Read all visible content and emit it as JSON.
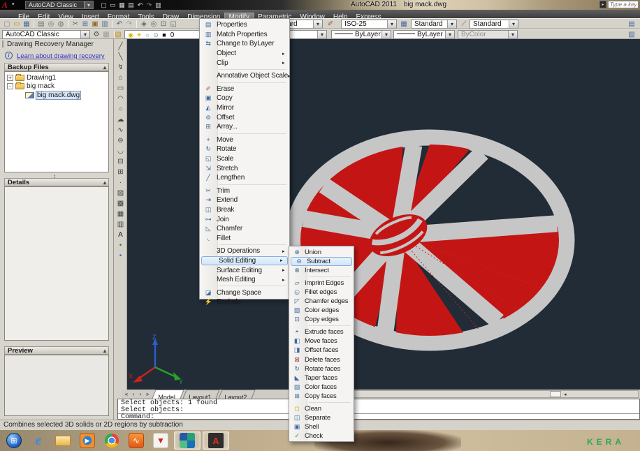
{
  "window": {
    "workspace": "AutoCAD Classic",
    "title_app": "AutoCAD 2011",
    "title_doc": "big mack.dwg",
    "search_placeholder": "Type a keyw",
    "menu_items": [
      {
        "label": "File"
      },
      {
        "label": "Edit"
      },
      {
        "label": "View"
      },
      {
        "label": "Insert"
      },
      {
        "label": "Format"
      },
      {
        "label": "Tools"
      },
      {
        "label": "Draw"
      },
      {
        "label": "Dimension"
      },
      {
        "label": "Modify",
        "cls": "active"
      },
      {
        "label": "Parametric"
      },
      {
        "label": "Window"
      },
      {
        "label": "Help"
      },
      {
        "label": "Express"
      }
    ],
    "qat_icons": [
      {
        "name": "qat-new-icon",
        "glyph": "▢",
        "color": "#ddd"
      },
      {
        "name": "qat-open-icon",
        "glyph": "▭",
        "color": "#ddd"
      },
      {
        "name": "qat-save-icon",
        "glyph": "▦",
        "color": "#ddd"
      },
      {
        "name": "qat-plot-icon",
        "glyph": "▤",
        "color": "#ddd"
      },
      {
        "name": "qat-undo-icon",
        "glyph": "↶",
        "color": "#ddd"
      },
      {
        "name": "qat-redo-icon",
        "glyph": "↷",
        "color": "#888"
      },
      {
        "name": "qat-print-icon",
        "glyph": "▥",
        "color": "#ddd"
      }
    ]
  },
  "toolbar_main": {
    "icons": [
      {
        "name": "new-icon",
        "glyph": "▢",
        "color": "#888"
      },
      {
        "name": "open-icon",
        "glyph": "▭",
        "color": "#c09020"
      },
      {
        "name": "save-icon",
        "glyph": "▦",
        "color": "#4a6da0"
      },
      {
        "type": "sep"
      },
      {
        "name": "plot-icon",
        "glyph": "▤",
        "color": "#777"
      },
      {
        "name": "plot-preview-icon",
        "glyph": "◎",
        "color": "#777"
      },
      {
        "name": "publish-icon",
        "glyph": "◍",
        "color": "#777"
      },
      {
        "type": "sep"
      },
      {
        "name": "cut-icon",
        "glyph": "✂",
        "color": "#666"
      },
      {
        "name": "copy-clip-icon",
        "glyph": "⊞",
        "color": "#4a6da0"
      },
      {
        "name": "paste-icon",
        "glyph": "▣",
        "color": "#8a6a30"
      },
      {
        "name": "match-properties-icon",
        "glyph": "▥",
        "color": "#4a6da0"
      },
      {
        "type": "sep"
      },
      {
        "name": "undo-icon",
        "glyph": "↶",
        "color": "#3a5a9a"
      },
      {
        "name": "redo-icon",
        "glyph": "↷",
        "color": "#9aa0a8"
      },
      {
        "type": "sep"
      },
      {
        "name": "pan-icon",
        "glyph": "◈",
        "color": "#666"
      },
      {
        "name": "zoom-realtime-icon",
        "glyph": "◎",
        "color": "#666"
      },
      {
        "name": "zoom-window-icon",
        "glyph": "⊡",
        "color": "#666"
      },
      {
        "name": "zoom-previous-icon",
        "glyph": "◱",
        "color": "#666"
      }
    ],
    "text_style": "Standard",
    "dim_style": "ISO-25",
    "table_style": "Standard",
    "multileader_style": "Standard"
  },
  "toolbar_secondary": {
    "workspace": "AutoCAD Classic",
    "layer_icons": [
      {
        "name": "layer-bulb-icon",
        "glyph": "◉",
        "color": "#d8b400"
      },
      {
        "name": "layer-sun-icon",
        "glyph": "☀",
        "color": "#d8b400"
      },
      {
        "name": "layer-freeze-icon",
        "glyph": "☼",
        "color": "#8898a8"
      },
      {
        "name": "layer-lock-icon",
        "glyph": "⊙",
        "color": "#888"
      },
      {
        "name": "layer-color-swatch",
        "glyph": "■",
        "color": "#111"
      }
    ],
    "layer": "0",
    "linetype": "ByLayer",
    "lineweight": "ByLayer",
    "plotstyle": "ByColor"
  },
  "draw_toolbar": {
    "icons": [
      {
        "name": "line-icon",
        "glyph": "╱"
      },
      {
        "name": "construction-line-icon",
        "glyph": "╲"
      },
      {
        "name": "polyline-icon",
        "glyph": "↯"
      },
      {
        "name": "polygon-icon",
        "glyph": "⌂"
      },
      {
        "name": "rectangle-icon",
        "glyph": "▭"
      },
      {
        "name": "arc-icon",
        "glyph": "◠"
      },
      {
        "name": "circle-icon",
        "glyph": "○"
      },
      {
        "name": "revision-cloud-icon",
        "glyph": "☁"
      },
      {
        "name": "spline-icon",
        "glyph": "∿"
      },
      {
        "name": "ellipse-icon",
        "glyph": "⊜"
      },
      {
        "name": "ellipse-arc-icon",
        "glyph": "◡"
      },
      {
        "name": "insert-block-icon",
        "glyph": "⊟"
      },
      {
        "name": "make-block-icon",
        "glyph": "⊞"
      },
      {
        "name": "point-icon",
        "glyph": "·"
      },
      {
        "name": "hatch-icon",
        "glyph": "▨"
      },
      {
        "name": "gradient-icon",
        "glyph": "▩"
      },
      {
        "name": "region-icon",
        "glyph": "▦"
      },
      {
        "name": "table-icon",
        "glyph": "▥"
      },
      {
        "name": "multiline-text-icon",
        "glyph": "A",
        "color": "#222"
      },
      {
        "name": "point-style-dot-icon",
        "glyph": "•",
        "color": "#2a8a2a"
      },
      {
        "name": "osnap-dot-icon",
        "glyph": "•",
        "color": "#3a6ac8"
      }
    ]
  },
  "palette": {
    "title": "Drawing Recovery Manager",
    "info_link": "Learn about drawing recovery",
    "backup_header": "Backup Files",
    "details_header": "Details",
    "preview_header": "Preview",
    "tree": [
      {
        "label": "Drawing1",
        "exp": "+",
        "cls": "lvl0 folder"
      },
      {
        "label": "big mack",
        "exp": "-",
        "cls": "lvl0 folder"
      },
      {
        "label": "big mack.dwg",
        "cls": "lvl1 file noexp selected"
      }
    ]
  },
  "modify_menu": {
    "items": [
      {
        "label": "Properties",
        "glyph": "▤",
        "color": "#3b6aa0"
      },
      {
        "label": "Match Properties",
        "glyph": "▥",
        "color": "#3b6aa0"
      },
      {
        "label": "Change to ByLayer",
        "glyph": "⇆",
        "color": "#3b6aa0"
      },
      {
        "label": "Object",
        "cls": "sub"
      },
      {
        "label": "Clip",
        "cls": "sub"
      },
      {
        "type": "sep"
      },
      {
        "label": "Annotative Object Scale",
        "cls": "sub"
      },
      {
        "type": "sep"
      },
      {
        "label": "Erase",
        "glyph": "✐",
        "color": "#b05050"
      },
      {
        "label": "Copy",
        "glyph": "▣",
        "color": "#3b6aa0"
      },
      {
        "label": "Mirror",
        "glyph": "◭",
        "color": "#3b6aa0"
      },
      {
        "label": "Offset",
        "glyph": "⊚",
        "color": "#3b6aa0"
      },
      {
        "label": "Array...",
        "glyph": "⊞",
        "color": "#3b6aa0"
      },
      {
        "type": "sep"
      },
      {
        "label": "Move",
        "glyph": "+",
        "color": "#3b6aa0"
      },
      {
        "label": "Rotate",
        "glyph": "↻",
        "color": "#3b6aa0"
      },
      {
        "label": "Scale",
        "glyph": "◱",
        "color": "#3b6aa0"
      },
      {
        "label": "Stretch",
        "glyph": "⇲",
        "color": "#3b6aa0"
      },
      {
        "label": "Lengthen",
        "glyph": "╱",
        "color": "#3b6aa0"
      },
      {
        "type": "sep"
      },
      {
        "label": "Trim",
        "glyph": "✂",
        "color": "#3b6aa0"
      },
      {
        "label": "Extend",
        "glyph": "⇥",
        "color": "#3b6aa0"
      },
      {
        "label": "Break",
        "glyph": "◫",
        "color": "#3b6aa0"
      },
      {
        "label": "Join",
        "glyph": "⊶",
        "color": "#3b6aa0"
      },
      {
        "label": "Chamfer",
        "glyph": "◺",
        "color": "#3b6aa0"
      },
      {
        "label": "Fillet",
        "glyph": "◟",
        "color": "#3b6aa0"
      },
      {
        "type": "sep"
      },
      {
        "label": "3D Operations",
        "cls": "sub"
      },
      {
        "label": "Solid Editing",
        "cls": "sub hl"
      },
      {
        "label": "Surface Editing",
        "cls": "sub"
      },
      {
        "label": "Mesh Editing",
        "cls": "sub"
      },
      {
        "type": "sep"
      },
      {
        "label": "Change Space",
        "glyph": "◪",
        "color": "#3b6aa0"
      },
      {
        "label": "Explode",
        "glyph": "⚡",
        "color": "#c8a000"
      }
    ]
  },
  "solid_menu": {
    "items": [
      {
        "label": "Union",
        "glyph": "⊕",
        "color": "#3b6aa0"
      },
      {
        "label": "Subtract",
        "glyph": "⊖",
        "color": "#3b6aa0",
        "cls": "hl"
      },
      {
        "label": "Intersect",
        "glyph": "⊗",
        "color": "#3b6aa0"
      },
      {
        "type": "sep"
      },
      {
        "label": "Imprint Edges",
        "glyph": "▱",
        "color": "#3b6aa0"
      },
      {
        "label": "Fillet edges",
        "glyph": "◵",
        "color": "#3b6aa0"
      },
      {
        "label": "Chamfer edges",
        "glyph": "◸",
        "color": "#3b6aa0"
      },
      {
        "label": "Color edges",
        "glyph": "▧",
        "color": "#3b6aa0"
      },
      {
        "label": "Copy edges",
        "glyph": "⊡",
        "color": "#3b6aa0"
      },
      {
        "type": "sep"
      },
      {
        "label": "Extrude faces",
        "glyph": "◓",
        "color": "#3b6aa0"
      },
      {
        "label": "Move faces",
        "glyph": "◧",
        "color": "#3b6aa0"
      },
      {
        "label": "Offset faces",
        "glyph": "◨",
        "color": "#3b6aa0"
      },
      {
        "label": "Delete faces",
        "glyph": "⊠",
        "color": "#a04040"
      },
      {
        "label": "Rotate faces",
        "glyph": "↻",
        "color": "#3b6aa0"
      },
      {
        "label": "Taper faces",
        "glyph": "◣",
        "color": "#3b6aa0"
      },
      {
        "label": "Color faces",
        "glyph": "▨",
        "color": "#3b6aa0"
      },
      {
        "label": "Copy faces",
        "glyph": "⊞",
        "color": "#3b6aa0"
      },
      {
        "type": "sep"
      },
      {
        "label": "Clean",
        "glyph": "◻",
        "color": "#c8a000"
      },
      {
        "label": "Separate",
        "glyph": "◫",
        "color": "#3b6aa0"
      },
      {
        "label": "Shell",
        "glyph": "▣",
        "color": "#3b6aa0"
      },
      {
        "label": "Check",
        "glyph": "✓",
        "color": "#2e8b2e"
      }
    ]
  },
  "drawing": {
    "nav_icons": [
      {
        "name": "tab-first-icon",
        "glyph": "«"
      },
      {
        "name": "tab-prev-icon",
        "glyph": "‹"
      },
      {
        "name": "tab-next-icon",
        "glyph": "›"
      },
      {
        "name": "tab-last-icon",
        "glyph": "»"
      }
    ],
    "tabs": [
      {
        "label": "Model",
        "cls": "active"
      },
      {
        "label": "Layout1"
      },
      {
        "label": "Layout2"
      }
    ],
    "ucs": {
      "x": "X",
      "y": "Y",
      "z": "Z"
    }
  },
  "command_line": {
    "lines": [
      {
        "text": "Select objects: 1 found"
      },
      {
        "text": "Select objects:"
      }
    ],
    "prompt": "Command:"
  },
  "status_bar": {
    "text": "Combines selected 3D solids or 2D regions by subtraction"
  },
  "taskbar": {
    "icons": [
      {
        "name": "start-button",
        "cls": "win",
        "glyph": "⊞"
      },
      {
        "name": "internet-explorer-icon",
        "cls": "ie",
        "glyph": "e"
      },
      {
        "name": "explorer-folder-icon",
        "cls": "folder"
      },
      {
        "name": "media-player-icon",
        "cls": "wmp",
        "glyph": "▶"
      },
      {
        "name": "chrome-icon",
        "cls": "chrome"
      },
      {
        "name": "media-app-icon",
        "cls": "orangeapp",
        "glyph": "∿"
      },
      {
        "name": "red-arrow-app-icon",
        "cls": "redapp",
        "glyph": "▼"
      },
      {
        "name": "pinwheel-app-icon",
        "cls": "active pinwheel"
      },
      {
        "name": "autocad-taskbar-icon",
        "cls": "active acad",
        "glyph": "A"
      }
    ]
  },
  "desktop": {
    "wallpaper_text": "KERA"
  },
  "accent_colors": {
    "wheel_gray": "#c6c6c6",
    "wheel_red": "#c41515",
    "canvas_bg": "#212c37"
  }
}
